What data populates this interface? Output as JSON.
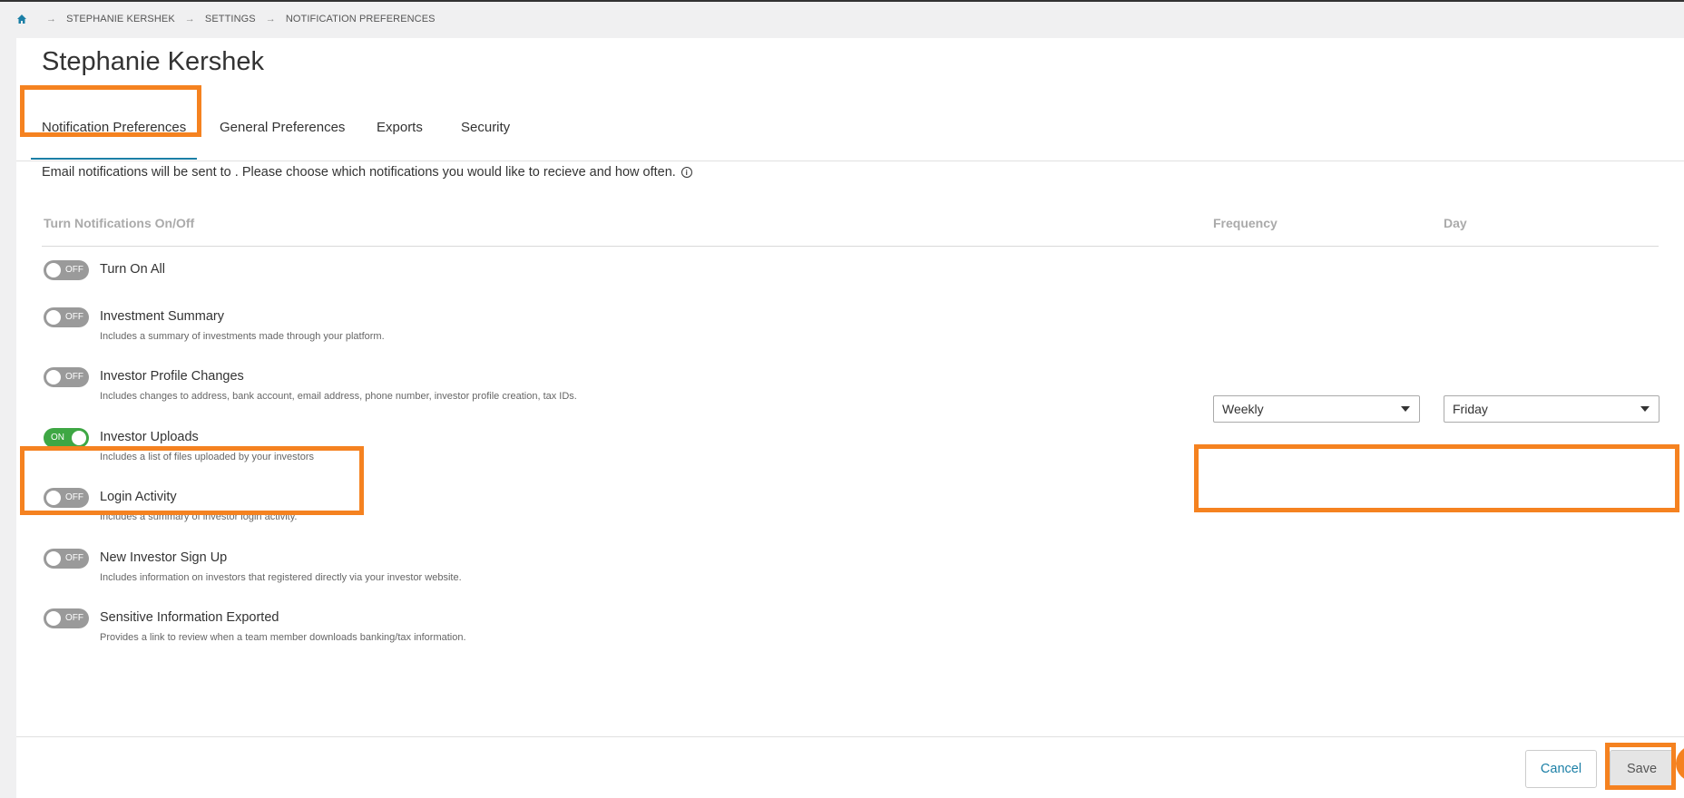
{
  "breadcrumb": {
    "items": [
      "STEPHANIE KERSHEK",
      "SETTINGS",
      "NOTIFICATION PREFERENCES"
    ]
  },
  "page": {
    "title": "Stephanie Kershek",
    "intro": "Email notifications will be sent to . Please choose which notifications you would like to recieve and how often."
  },
  "tabs": [
    {
      "label": "Notification Preferences",
      "active": true
    },
    {
      "label": "General Preferences"
    },
    {
      "label": "Exports"
    },
    {
      "label": "Security"
    }
  ],
  "table_headers": {
    "toggle": "Turn Notifications On/Off",
    "frequency": "Frequency",
    "day": "Day"
  },
  "notifications": [
    {
      "label": "Turn On All",
      "desc": "",
      "state": "OFF"
    },
    {
      "label": "Investment Summary",
      "desc": "Includes a summary of investments made through your platform.",
      "state": "OFF"
    },
    {
      "label": "Investor Profile Changes",
      "desc": "Includes changes to address, bank account, email address, phone number, investor profile creation, tax IDs.",
      "state": "OFF"
    },
    {
      "label": "Investor Uploads",
      "desc": "Includes a list of files uploaded by your investors",
      "state": "ON",
      "frequency": "Weekly",
      "day": "Friday"
    },
    {
      "label": "Login Activity",
      "desc": "Includes a summary of investor login activity.",
      "state": "OFF"
    },
    {
      "label": "New Investor Sign Up",
      "desc": "Includes information on investors that registered directly via your investor website.",
      "state": "OFF"
    },
    {
      "label": "Sensitive Information Exported",
      "desc": "Provides a link to review when a team member downloads banking/tax information.",
      "state": "OFF"
    }
  ],
  "footer": {
    "cancel_label": "Cancel",
    "save_label": "Save"
  },
  "colors": {
    "accent": "#1b7fa6",
    "toggle_on": "#3ea744",
    "toggle_off": "#9a9a9a",
    "highlight": "#f58220"
  },
  "icons": [
    "home-icon",
    "chevron-right-icon",
    "info-icon",
    "caret-down-icon"
  ]
}
